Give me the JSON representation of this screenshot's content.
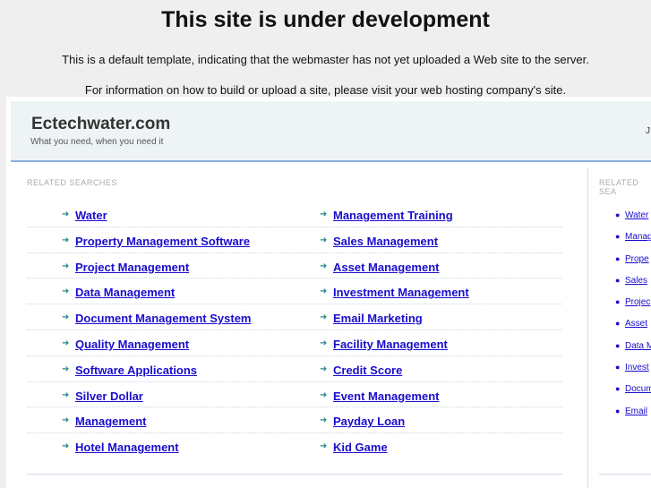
{
  "notice": {
    "title": "This site is under development",
    "line1": "This is a default template, indicating that the webmaster has not yet uploaded a Web site to the server.",
    "line2": "For information on how to build or upload a site, please visit your web hosting company's site."
  },
  "header": {
    "site": "Ectechwater.com",
    "tagline": "What you need, when you need it",
    "right_fragment": "J"
  },
  "main": {
    "heading": "RELATED SEARCHES",
    "left": [
      "Water",
      "Property Management Software",
      "Project Management",
      "Data Management",
      "Document Management System",
      "Quality Management",
      "Software Applications",
      "Silver Dollar",
      "Management",
      "Hotel Management"
    ],
    "right": [
      "Management Training",
      "Sales Management",
      "Asset Management",
      "Investment Management",
      "Email Marketing",
      "Facility Management",
      "Credit Score",
      "Event Management",
      "Payday Loan",
      "Kid Game"
    ]
  },
  "sidebar": {
    "heading": "RELATED SEA",
    "items": [
      "Water",
      "Manag",
      "Prope",
      "Sales",
      "Projec",
      "Asset",
      "Data M",
      "Invest",
      "Docum",
      "Email"
    ]
  },
  "colors": {
    "link": "#1a0dcc",
    "arrow": "#2a8a8a",
    "header_bg": "#eef4f6"
  }
}
